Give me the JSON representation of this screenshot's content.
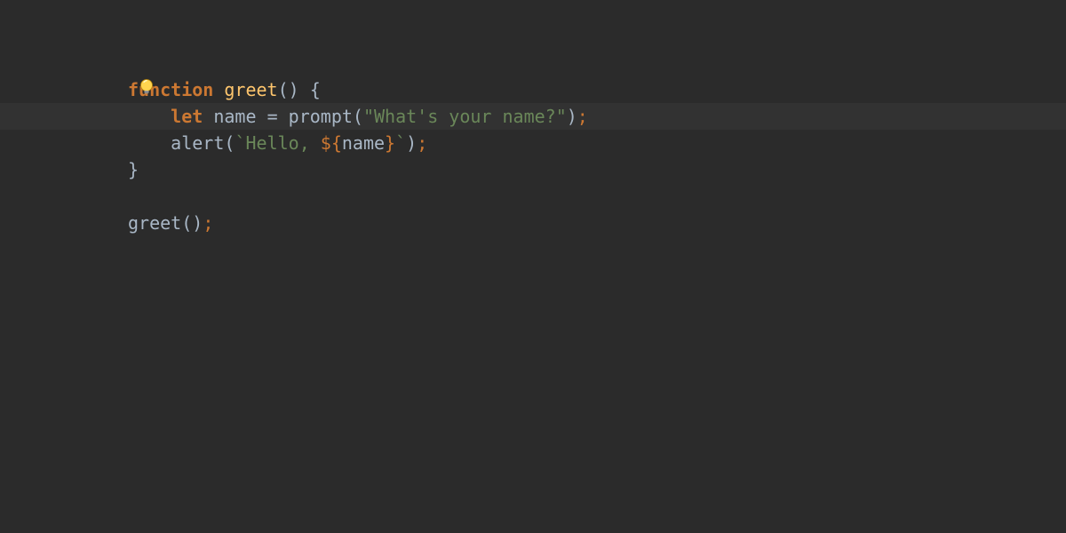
{
  "editor": {
    "bulb_icon": "lightbulb-icon",
    "lines": {
      "l1": {
        "kw_function": "function",
        "fn_name": "greet",
        "after": "() {"
      },
      "l2": {
        "indent": "    ",
        "kw_let": "let",
        "space1": " ",
        "var": "name",
        "space2": " ",
        "op": "=",
        "space3": " ",
        "call": "prompt",
        "paren_open": "(",
        "str": "\"What's your name?\"",
        "paren_close": ")",
        "semi": ";"
      },
      "l3": {
        "indent": "    ",
        "call": "alert",
        "paren_open": "(",
        "backtick1": "`",
        "txt": "Hello, ",
        "interp_open": "${",
        "var": "name",
        "interp_close": "}",
        "backtick2": "`",
        "paren_close": ")",
        "semi": ";"
      },
      "l4": {
        "brace": "}"
      },
      "l5": {
        "empty": ""
      },
      "l6": {
        "call": "greet",
        "parens": "()",
        "semi": ";"
      }
    }
  }
}
